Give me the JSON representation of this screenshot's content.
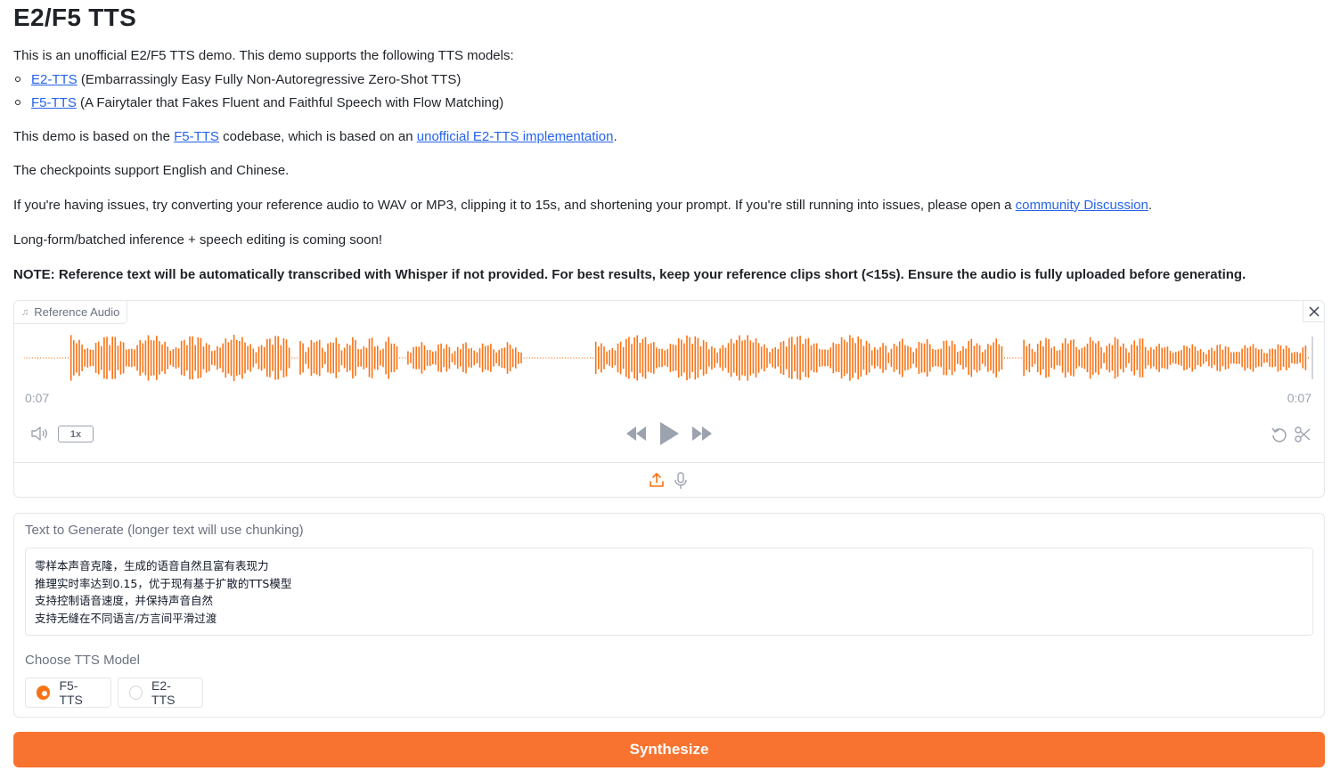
{
  "header": {
    "title": "E2/F5 TTS"
  },
  "intro": {
    "line1": "This is an unofficial E2/F5 TTS demo. This demo supports the following TTS models:",
    "models": [
      {
        "link": "E2-TTS",
        "desc": " (Embarrassingly Easy Fully Non-Autoregressive Zero-Shot TTS)"
      },
      {
        "link": "F5-TTS",
        "desc": " (A Fairytaler that Fakes Fluent and Faithful Speech with Flow Matching)"
      }
    ],
    "based_prefix": "This demo is based on the ",
    "based_link1": "F5-TTS",
    "based_mid": " codebase, which is based on an ",
    "based_link2": "unofficial E2-TTS implementation",
    "based_suffix": ".",
    "checkpoints": "The checkpoints support English and Chinese.",
    "issues_prefix": "If you're having issues, try converting your reference audio to WAV or MP3, clipping it to 15s, and shortening your prompt. If you're still running into issues, please open a ",
    "issues_link": "community Discussion",
    "issues_suffix": ".",
    "coming_soon": "Long-form/batched inference + speech editing is coming soon!",
    "note": "NOTE: Reference text will be automatically transcribed with Whisper if not provided. For best results, keep your reference clips short (<15s). Ensure the audio is fully uploaded before generating."
  },
  "audio": {
    "label": "Reference Audio",
    "label_icon": "music-note-icon",
    "time_current": "0:07",
    "time_total": "0:07",
    "speed": "1x",
    "wave_color": "#f97316",
    "progress": 1.0
  },
  "text_input": {
    "label": "Text to Generate (longer text will use chunking)",
    "value": "零样本声音克隆，生成的语音自然且富有表现力\n推理实时率达到0.15，优于现有基于扩散的TTS模型\n支持控制语音速度，并保持声音自然\n支持无缝在不同语言/方言间平滑过渡"
  },
  "model_choice": {
    "label": "Choose TTS Model",
    "options": [
      {
        "label": "F5-TTS",
        "selected": true
      },
      {
        "label": "E2-TTS",
        "selected": false
      }
    ]
  },
  "actions": {
    "synthesize": "Synthesize"
  },
  "colors": {
    "accent": "#f97316",
    "link": "#2563eb",
    "button": "#f97330"
  }
}
